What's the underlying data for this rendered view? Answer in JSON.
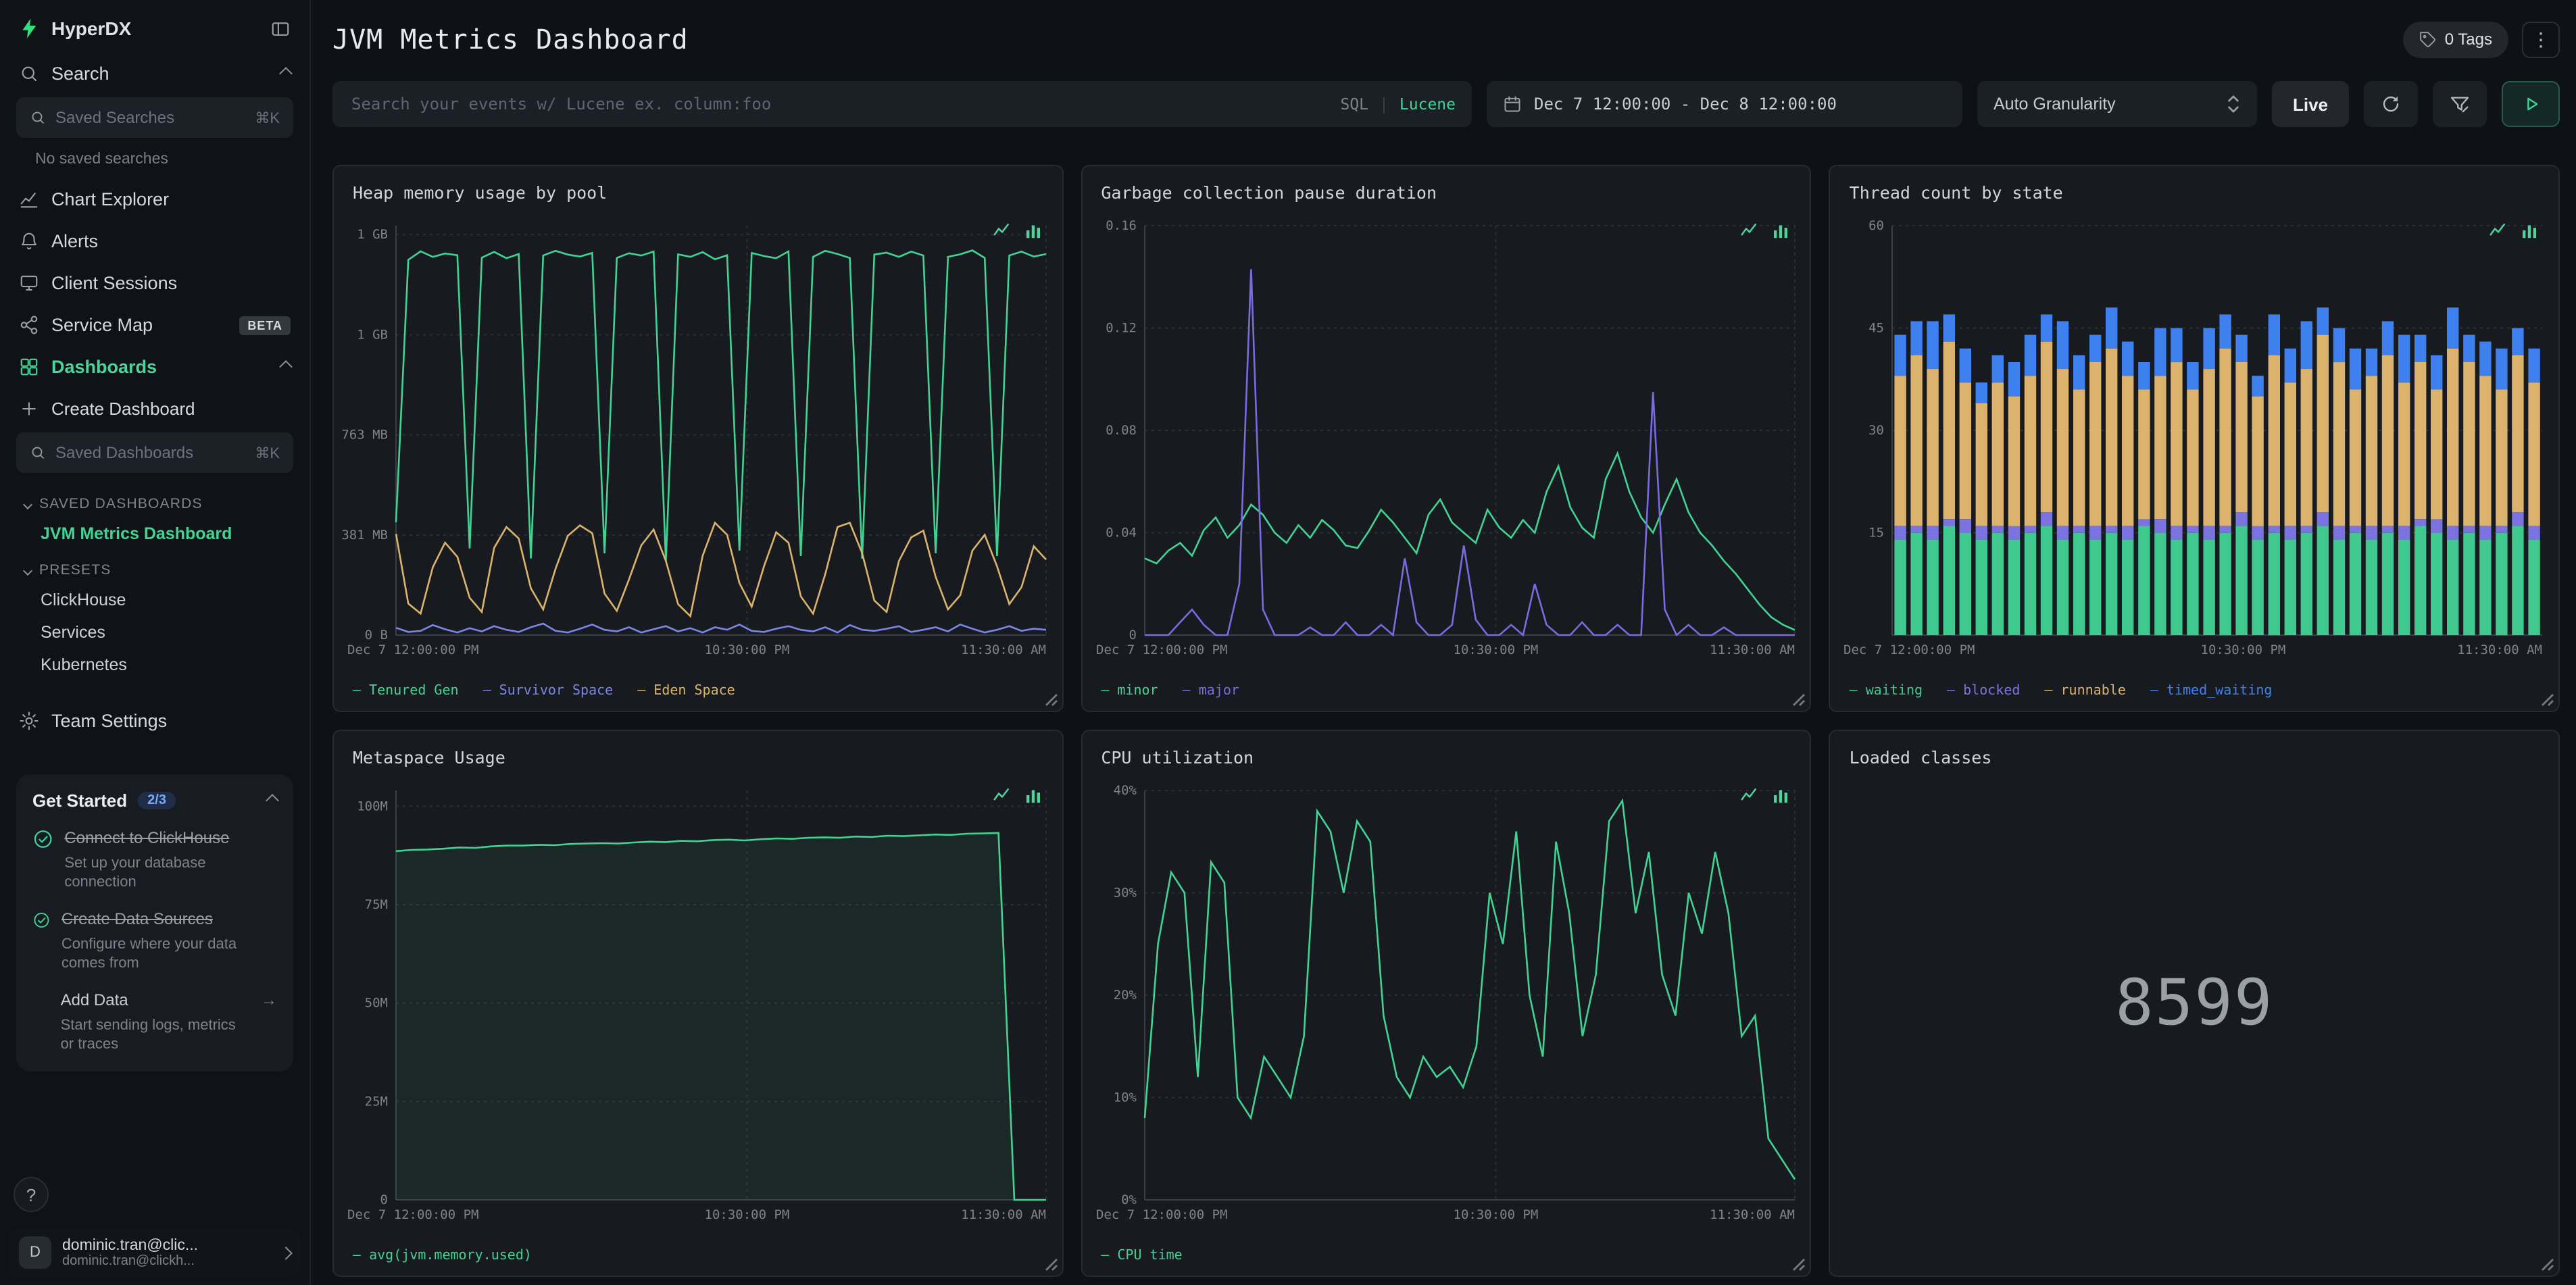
{
  "app": {
    "brand": "HyperDX"
  },
  "sidebar": {
    "search": {
      "label": "Search",
      "input_placeholder": "Saved Searches",
      "shortcut": "⌘K",
      "empty": "No saved searches"
    },
    "nav": {
      "chart_explorer": "Chart Explorer",
      "alerts": "Alerts",
      "client_sessions": "Client Sessions",
      "service_map": "Service Map",
      "service_map_badge": "BETA",
      "dashboards": "Dashboards",
      "create_dashboard": "Create Dashboard"
    },
    "dashboards_search": {
      "placeholder": "Saved Dashboards",
      "shortcut": "⌘K"
    },
    "saved_group_label": "SAVED DASHBOARDS",
    "saved_dashboard_active": "JVM Metrics Dashboard",
    "presets_label": "PRESETS",
    "presets": [
      "ClickHouse",
      "Services",
      "Kubernetes"
    ],
    "team_settings": "Team Settings",
    "get_started": {
      "title": "Get Started",
      "progress": "2/3",
      "tasks": [
        {
          "title": "Connect to ClickHouse",
          "desc": "Set up your database connection",
          "done": true
        },
        {
          "title": "Create Data Sources",
          "desc": "Configure where your data comes from",
          "done": true
        },
        {
          "title": "Add Data",
          "desc": "Start sending logs, metrics or traces",
          "done": false
        }
      ]
    },
    "help_label": "?",
    "user": {
      "initial": "D",
      "name": "dominic.tran@clic...",
      "email": "dominic.tran@clickh..."
    }
  },
  "header": {
    "title": "JVM Metrics Dashboard",
    "tags_label": "0 Tags",
    "menu_icon": "⋮"
  },
  "filter_bar": {
    "search_placeholder": "Search your events w/ Lucene ex. column:foo",
    "sql_label": "SQL",
    "lucene_label": "Lucene",
    "date_range": "Dec 7 12:00:00 - Dec 8 12:00:00",
    "granularity": "Auto Granularity",
    "live_label": "Live"
  },
  "chart_data": [
    {
      "type": "line",
      "title": "Heap memory usage by pool",
      "ymax": 1560,
      "yticks": [
        {
          "value": 0,
          "label": "0 B"
        },
        {
          "value": 381,
          "label": "381 MB"
        },
        {
          "value": 763,
          "label": "763 MB"
        },
        {
          "value": 1144,
          "label": "1 GB"
        },
        {
          "value": 1526,
          "label": "1 GB"
        }
      ],
      "xticks": [
        {
          "pos": 0,
          "label": "Dec 7 12:00:00 PM"
        },
        {
          "pos": 0.54,
          "label": "10:30:00 PM"
        },
        {
          "pos": 1,
          "label": "11:30:00 AM"
        }
      ],
      "vgrid": [
        0.54,
        1
      ],
      "series": [
        {
          "name": "Tenured Gen",
          "color": "#42d392",
          "values": [
            430,
            1430,
            1462,
            1441,
            1454,
            1447,
            330,
            1438,
            1460,
            1436,
            1452,
            292,
            1446,
            1464,
            1450,
            1442,
            1456,
            312,
            1437,
            1455,
            1446,
            1461,
            281,
            1451,
            1441,
            1459,
            1432,
            1447,
            322,
            1456,
            1444,
            1436,
            1462,
            301,
            1441,
            1464,
            1452,
            1437,
            291,
            1450,
            1457,
            1441,
            1461,
            1446,
            312,
            1441,
            1451,
            1466,
            1437,
            301,
            1446,
            1461,
            1442,
            1452
          ]
        },
        {
          "name": "Survivor Space",
          "color": "#7c86e8",
          "values": [
            28,
            12,
            16,
            38,
            22,
            10,
            26,
            14,
            34,
            20,
            12,
            30,
            44,
            16,
            10,
            24,
            40,
            20,
            14,
            30,
            10,
            22,
            34,
            14,
            26,
            10,
            30,
            20,
            40,
            16,
            12,
            24,
            34,
            20,
            14,
            30,
            10,
            38,
            20,
            16,
            24,
            34,
            12,
            20,
            30,
            14,
            40,
            24,
            10,
            20,
            34,
            16,
            24,
            20
          ]
        },
        {
          "name": "Eden Space",
          "color": "#dcb36c",
          "values": [
            385,
            120,
            82,
            258,
            352,
            298,
            142,
            88,
            332,
            412,
            368,
            178,
            98,
            252,
            378,
            418,
            388,
            158,
            92,
            212,
            342,
            402,
            282,
            118,
            72,
            302,
            428,
            382,
            198,
            108,
            262,
            392,
            352,
            148,
            82,
            232,
            412,
            428,
            312,
            132,
            88,
            282,
            372,
            398,
            222,
            98,
            152,
            322,
            382,
            262,
            118,
            182,
            338,
            288
          ]
        }
      ],
      "legend": [
        {
          "label": "Tenured Gen",
          "color": "#42d392"
        },
        {
          "label": "Survivor Space",
          "color": "#7c86e8"
        },
        {
          "label": "Eden Space",
          "color": "#dcb36c"
        }
      ]
    },
    {
      "type": "line",
      "title": "Garbage collection pause duration",
      "ymax": 0.16,
      "yticks": [
        {
          "value": 0,
          "label": "0"
        },
        {
          "value": 0.04,
          "label": "0.04"
        },
        {
          "value": 0.08,
          "label": "0.08"
        },
        {
          "value": 0.12,
          "label": "0.12"
        },
        {
          "value": 0.16,
          "label": "0.16"
        }
      ],
      "xticks": [
        {
          "pos": 0,
          "label": "Dec 7 12:00:00 PM"
        },
        {
          "pos": 0.54,
          "label": "10:30:00 PM"
        },
        {
          "pos": 1,
          "label": "11:30:00 AM"
        }
      ],
      "vgrid": [
        0.54,
        1
      ],
      "series": [
        {
          "name": "minor",
          "color": "#42d392",
          "values": [
            0.03,
            0.028,
            0.033,
            0.036,
            0.031,
            0.041,
            0.046,
            0.038,
            0.043,
            0.051,
            0.047,
            0.04,
            0.036,
            0.043,
            0.038,
            0.045,
            0.041,
            0.035,
            0.034,
            0.041,
            0.049,
            0.044,
            0.038,
            0.032,
            0.047,
            0.053,
            0.044,
            0.04,
            0.036,
            0.049,
            0.042,
            0.038,
            0.045,
            0.04,
            0.056,
            0.066,
            0.05,
            0.042,
            0.038,
            0.061,
            0.071,
            0.056,
            0.046,
            0.04,
            0.051,
            0.061,
            0.048,
            0.04,
            0.035,
            0.029,
            0.024,
            0.018,
            0.012,
            0.007,
            0.004,
            0.002
          ]
        },
        {
          "name": "major",
          "color": "#7c6ae0",
          "values": [
            0,
            0,
            0,
            0.005,
            0.01,
            0.004,
            0,
            0,
            0.02,
            0.143,
            0.01,
            0,
            0,
            0,
            0.003,
            0,
            0,
            0.005,
            0,
            0,
            0.004,
            0,
            0.03,
            0.005,
            0,
            0,
            0.004,
            0.035,
            0.006,
            0,
            0,
            0.004,
            0,
            0.02,
            0.004,
            0,
            0,
            0.005,
            0,
            0,
            0.004,
            0,
            0,
            0.095,
            0.01,
            0,
            0.004,
            0,
            0,
            0.003,
            0,
            0,
            0,
            0,
            0,
            0
          ]
        }
      ],
      "legend": [
        {
          "label": "minor",
          "color": "#42d392"
        },
        {
          "label": "major",
          "color": "#7c6ae0"
        }
      ]
    },
    {
      "type": "stacked_bar",
      "title": "Thread count by state",
      "ymax": 60,
      "yticks": [
        {
          "value": 15,
          "label": "15"
        },
        {
          "value": 30,
          "label": "30"
        },
        {
          "value": 45,
          "label": "45"
        },
        {
          "value": 60,
          "label": "60"
        }
      ],
      "xticks": [
        {
          "pos": 0,
          "label": "Dec 7 12:00:00 PM"
        },
        {
          "pos": 0.54,
          "label": "10:30:00 PM"
        },
        {
          "pos": 1,
          "label": "11:30:00 AM"
        }
      ],
      "vgrid": [],
      "series": [
        {
          "name": "waiting",
          "color": "#3fc98f",
          "values": [
            14,
            15,
            14,
            16,
            15,
            14,
            15,
            14,
            15,
            16,
            14,
            15,
            14,
            15,
            14,
            16,
            15,
            14,
            15,
            14,
            15,
            16,
            14,
            15,
            14,
            15,
            16,
            14,
            15,
            14,
            15,
            14,
            16,
            15,
            14,
            15,
            14,
            15,
            16,
            14
          ]
        },
        {
          "name": "blocked",
          "color": "#7b74e0",
          "values": [
            2,
            1,
            2,
            1,
            2,
            2,
            1,
            2,
            1,
            2,
            2,
            1,
            2,
            1,
            2,
            1,
            2,
            2,
            1,
            2,
            1,
            2,
            2,
            1,
            2,
            1,
            2,
            2,
            1,
            2,
            1,
            2,
            1,
            2,
            2,
            1,
            2,
            1,
            2,
            2
          ]
        },
        {
          "name": "runnable",
          "color": "#dcb36c",
          "values": [
            22,
            25,
            23,
            26,
            20,
            18,
            21,
            19,
            22,
            25,
            23,
            20,
            24,
            26,
            22,
            19,
            21,
            24,
            20,
            23,
            26,
            22,
            19,
            25,
            21,
            23,
            26,
            24,
            20,
            22,
            25,
            21,
            23,
            19,
            26,
            24,
            22,
            20,
            23,
            21
          ]
        },
        {
          "name": "timed_waiting",
          "color": "#3f80f0",
          "values": [
            6,
            5,
            7,
            4,
            5,
            3,
            4,
            5,
            6,
            4,
            7,
            5,
            4,
            6,
            5,
            4,
            7,
            5,
            4,
            6,
            5,
            4,
            3,
            6,
            5,
            7,
            4,
            5,
            6,
            4,
            5,
            7,
            4,
            5,
            6,
            4,
            5,
            6,
            4,
            5
          ]
        }
      ],
      "legend": [
        {
          "label": "waiting",
          "color": "#3fc98f"
        },
        {
          "label": "blocked",
          "color": "#7b74e0"
        },
        {
          "label": "runnable",
          "color": "#dcb36c"
        },
        {
          "label": "timed_waiting",
          "color": "#3f80f0"
        }
      ]
    },
    {
      "type": "line",
      "title": "Metaspace Usage",
      "ymax": 104,
      "yticks": [
        {
          "value": 0,
          "label": "0"
        },
        {
          "value": 25,
          "label": "25M"
        },
        {
          "value": 50,
          "label": "50M"
        },
        {
          "value": 75,
          "label": "75M"
        },
        {
          "value": 100,
          "label": "100M"
        }
      ],
      "xticks": [
        {
          "pos": 0,
          "label": "Dec 7 12:00:00 PM"
        },
        {
          "pos": 0.54,
          "label": "10:30:00 PM"
        },
        {
          "pos": 1,
          "label": "11:30:00 AM"
        }
      ],
      "vgrid": [
        0.54,
        1
      ],
      "series": [
        {
          "name": "avg(jvm.memory.used)",
          "color": "#42d392",
          "fill": true,
          "values": [
            88.6,
            88.9,
            89,
            89.2,
            89.5,
            89.4,
            89.8,
            90,
            90,
            90.2,
            90.1,
            90.4,
            90.5,
            90.6,
            90.5,
            90.8,
            91,
            90.9,
            91.2,
            91.1,
            91.4,
            91.5,
            91.3,
            91.6,
            91.8,
            91.7,
            92,
            92.1,
            92,
            92.3,
            92.2,
            92.5,
            92.4,
            92.6,
            92.8,
            92.7,
            93,
            93.1,
            93.2,
            0,
            0,
            0
          ]
        }
      ],
      "legend": [
        {
          "label": "avg(jvm.memory.used)",
          "color": "#42d392"
        }
      ]
    },
    {
      "type": "line",
      "title": "CPU utilization",
      "ymax": 40,
      "yticks": [
        {
          "value": 0,
          "label": "0%"
        },
        {
          "value": 10,
          "label": "10%"
        },
        {
          "value": 20,
          "label": "20%"
        },
        {
          "value": 30,
          "label": "30%"
        },
        {
          "value": 40,
          "label": "40%"
        }
      ],
      "xticks": [
        {
          "pos": 0,
          "label": "Dec 7 12:00:00 PM"
        },
        {
          "pos": 0.54,
          "label": "10:30:00 PM"
        },
        {
          "pos": 1,
          "label": "11:30:00 AM"
        }
      ],
      "vgrid": [
        0.54,
        1
      ],
      "series": [
        {
          "name": "CPU time",
          "color": "#42d392",
          "values": [
            8,
            25,
            32,
            30,
            12,
            33,
            31,
            10,
            8,
            14,
            12,
            10,
            16,
            38,
            36,
            30,
            37,
            35,
            18,
            12,
            10,
            14,
            12,
            13,
            11,
            15,
            30,
            25,
            36,
            20,
            14,
            35,
            28,
            16,
            22,
            37,
            39,
            28,
            34,
            22,
            18,
            30,
            26,
            34,
            28,
            16,
            18,
            6,
            4,
            2
          ]
        }
      ],
      "legend": [
        {
          "label": "CPU time",
          "color": "#42d392"
        }
      ]
    },
    {
      "type": "number",
      "title": "Loaded classes",
      "value": "8599"
    }
  ],
  "colors": {
    "brand_green": "#2ee37e",
    "accent_green": "#41d492",
    "panel_bg": "#171b20",
    "sidebar_bg": "#0f1217"
  }
}
